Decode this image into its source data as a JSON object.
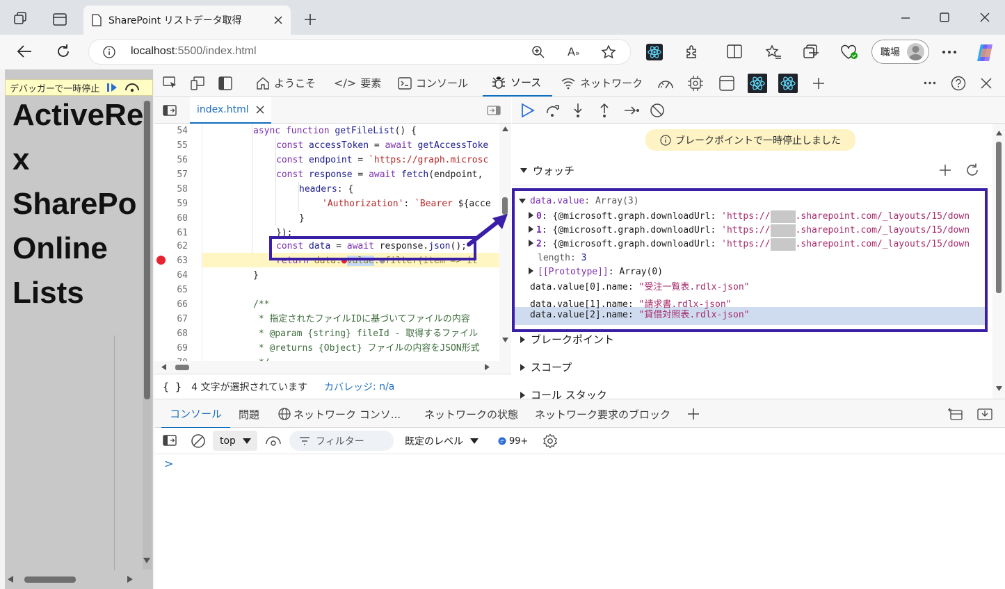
{
  "browser": {
    "tab_title": "SharePoint リストデータ取得",
    "url_host": "localhost",
    "url_path": ":5500/index.html",
    "profile_label": "職場"
  },
  "page": {
    "paused_label": "デバッガーで一時停止",
    "heading_lines": [
      "ActiveRe",
      "x",
      "SharePo",
      "Online",
      "Lists"
    ]
  },
  "devtools": {
    "tabs": [
      {
        "label": "ようこそ"
      },
      {
        "label": "要素"
      },
      {
        "label": "コンソール"
      },
      {
        "label": "ソース"
      },
      {
        "label": "ネットワーク"
      }
    ],
    "editor": {
      "file_tab": "index.html",
      "status_braces": "{ }",
      "status_selection": "4 文字が選択されています",
      "status_coverage_label": "カバレッジ",
      "status_coverage_value": ": n/a",
      "lines": [
        {
          "n": "54",
          "code": "async function getFileList() {"
        },
        {
          "n": "55",
          "code": "    const accessToken = await getAccessToke"
        },
        {
          "n": "56",
          "code": "    const endpoint = `https://graph.microsc"
        },
        {
          "n": "57",
          "code": "    const response = await fetch(endpoint,"
        },
        {
          "n": "58",
          "code": "        headers: {"
        },
        {
          "n": "59",
          "code": "            'Authorization': `Bearer ${acce"
        },
        {
          "n": "60",
          "code": "        }"
        },
        {
          "n": "61",
          "code": "    });"
        },
        {
          "n": "62",
          "code": "    const data = await response.json();"
        },
        {
          "n": "63",
          "code": "    return data.●value.●filter(item => it"
        },
        {
          "n": "64",
          "code": "}"
        },
        {
          "n": "65",
          "code": ""
        },
        {
          "n": "66",
          "code": "/**"
        },
        {
          "n": "67",
          "code": " * 指定されたファイルIDに基づいてファイルの内容"
        },
        {
          "n": "68",
          "code": " * @param {string} fileId - 取得するファイル"
        },
        {
          "n": "69",
          "code": " * @returns {Object} ファイルの内容をJSON形式"
        },
        {
          "n": "70",
          "code": " */"
        }
      ]
    },
    "debugger": {
      "pause_message": "ブレークポイントで一時停止しました",
      "watch_label": "ウォッチ",
      "watch_root": "data.value",
      "watch_root_value": "Array(3)",
      "items": [
        {
          "index": "0",
          "key": "@microsoft.graph.downloadUrl",
          "url_pre": "'https://",
          "url_post": ".sharepoint.com/_layouts/15/down"
        },
        {
          "index": "1",
          "key": "@microsoft.graph.downloadUrl",
          "url_pre": "'https://",
          "url_post": ".sharepoint.com/_layouts/15/down"
        },
        {
          "index": "2",
          "key": "@microsoft.graph.downloadUrl",
          "url_pre": "'https://",
          "url_post": ".sharepoint.com/_layouts/15/down"
        }
      ],
      "length_label": "length",
      "length_value": "3",
      "prototype_label": "[[Prototype]]",
      "prototype_value": "Array(0)",
      "expressions": [
        {
          "expr": "data.value[0].name",
          "value": "\"受注一覧表.rdlx-json\""
        },
        {
          "expr": "data.value[1].name",
          "value": "\"請求書.rdlx-json\""
        },
        {
          "expr": "data.value[2].name",
          "value": "\"貸借対照表.rdlx-json\""
        }
      ],
      "sections": [
        "ブレークポイント",
        "スコープ",
        "コール スタック"
      ]
    },
    "drawer": {
      "tabs": [
        "コンソール",
        "問題",
        "ネットワーク コンソ...",
        "ネットワークの状態",
        "ネットワーク要求のブロック"
      ],
      "context": "top",
      "filter_placeholder": "フィルター",
      "level": "既定のレベル",
      "issues_count": "99+",
      "prompt": ">"
    }
  },
  "colors": {
    "highlight_box": "#3b1ea8",
    "accent": "#0f6cbd",
    "breakpoint": "#e8222f"
  }
}
